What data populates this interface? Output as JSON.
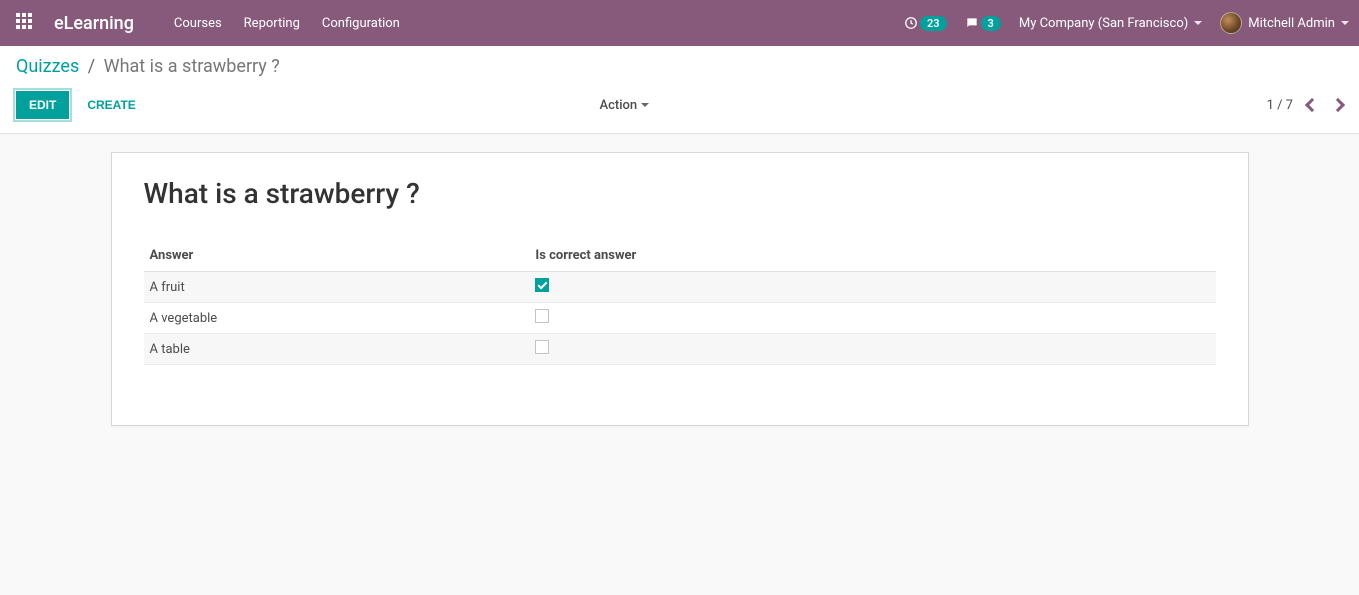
{
  "topbar": {
    "brand": "eLearning",
    "nav": [
      "Courses",
      "Reporting",
      "Configuration"
    ],
    "activity_count": "23",
    "messages_count": "3",
    "company": "My Company (San Francisco)",
    "user": "Mitchell Admin"
  },
  "breadcrumb": {
    "root": "Quizzes",
    "sep": "/",
    "current": "What is a strawberry ?"
  },
  "actions": {
    "edit": "Edit",
    "create": "Create",
    "action_menu": "Action",
    "pager": "1 / 7"
  },
  "form": {
    "title": "What is a strawberry ?",
    "columns": {
      "answer": "Answer",
      "is_correct": "Is correct answer"
    },
    "rows": [
      {
        "answer": "A fruit",
        "correct": true
      },
      {
        "answer": "A vegetable",
        "correct": false
      },
      {
        "answer": "A table",
        "correct": false
      }
    ]
  }
}
